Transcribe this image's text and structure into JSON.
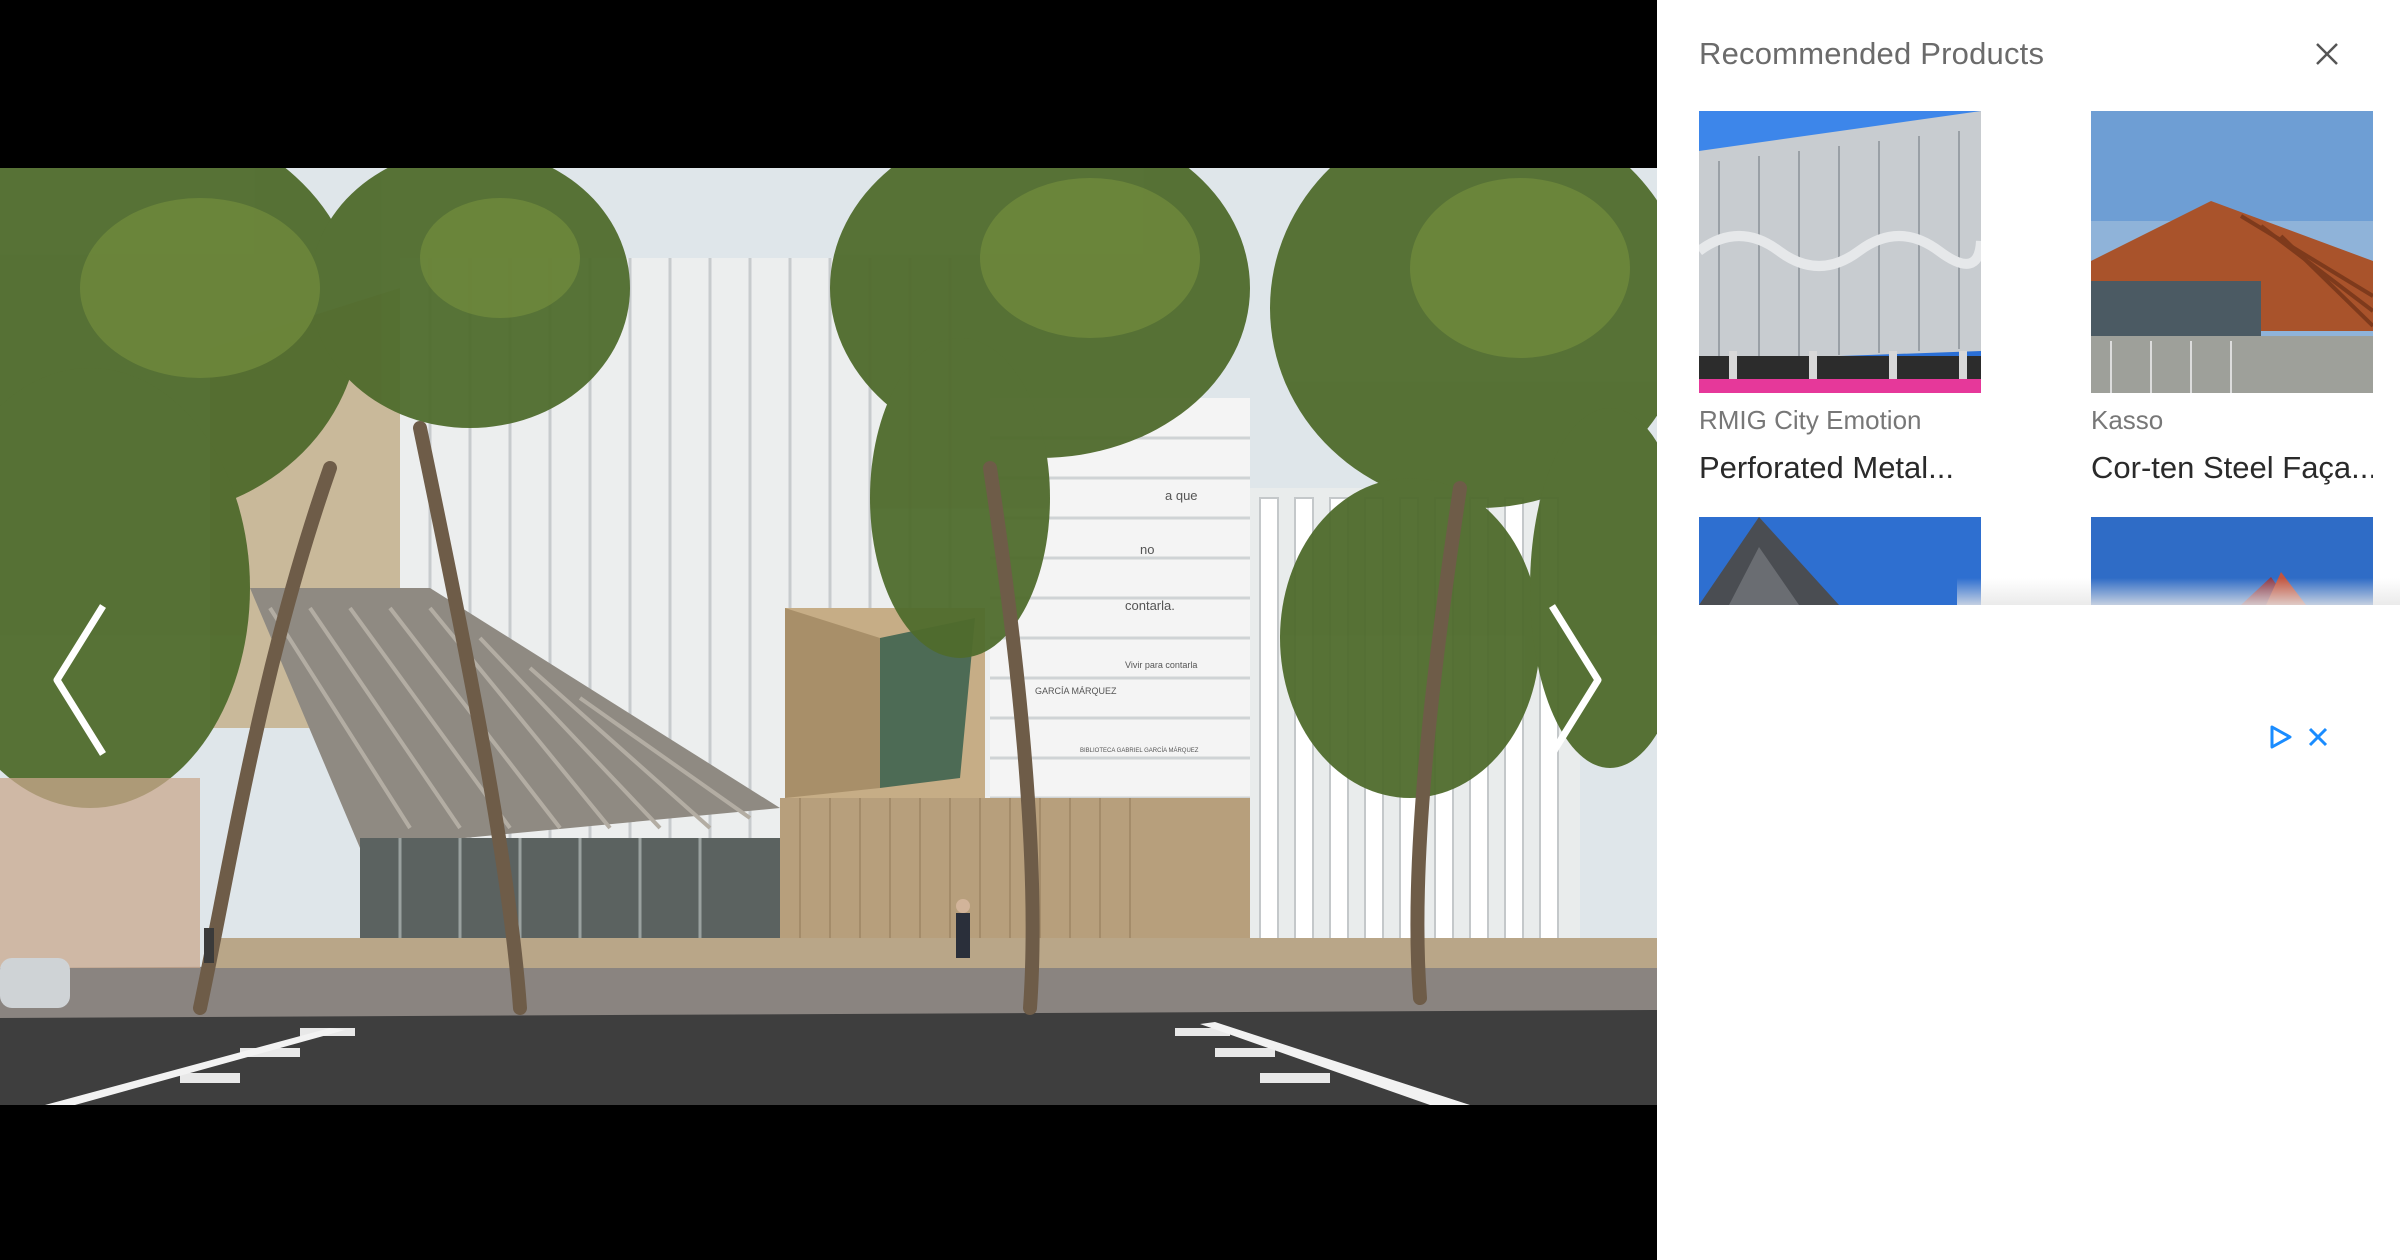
{
  "viewer": {
    "photo_alt": "Biblioteca Gabriel García Márquez",
    "facade_text": [
      "a que",
      "no",
      "contarla.",
      "Vivir para contarla",
      "GARCÍA MÁRQUEZ",
      "BIBLIOTECA GABRIEL GARCÍA MÁRQUEZ"
    ],
    "prev_icon": "chevron-left-icon",
    "next_icon": "chevron-right-icon"
  },
  "panel": {
    "title": "Recommended Products",
    "close_icon": "close-icon",
    "products": [
      {
        "brand": "RMIG City Emotion",
        "name": "Perforated Metal..."
      },
      {
        "brand": "Kasso",
        "name": "Cor-ten Steel Faça..."
      },
      {
        "brand": "",
        "name": ""
      },
      {
        "brand": "",
        "name": ""
      }
    ]
  },
  "ad": {
    "adchoices_icon": "adchoices-icon",
    "close_icon": "close-icon",
    "accent": "#1a8cff"
  }
}
